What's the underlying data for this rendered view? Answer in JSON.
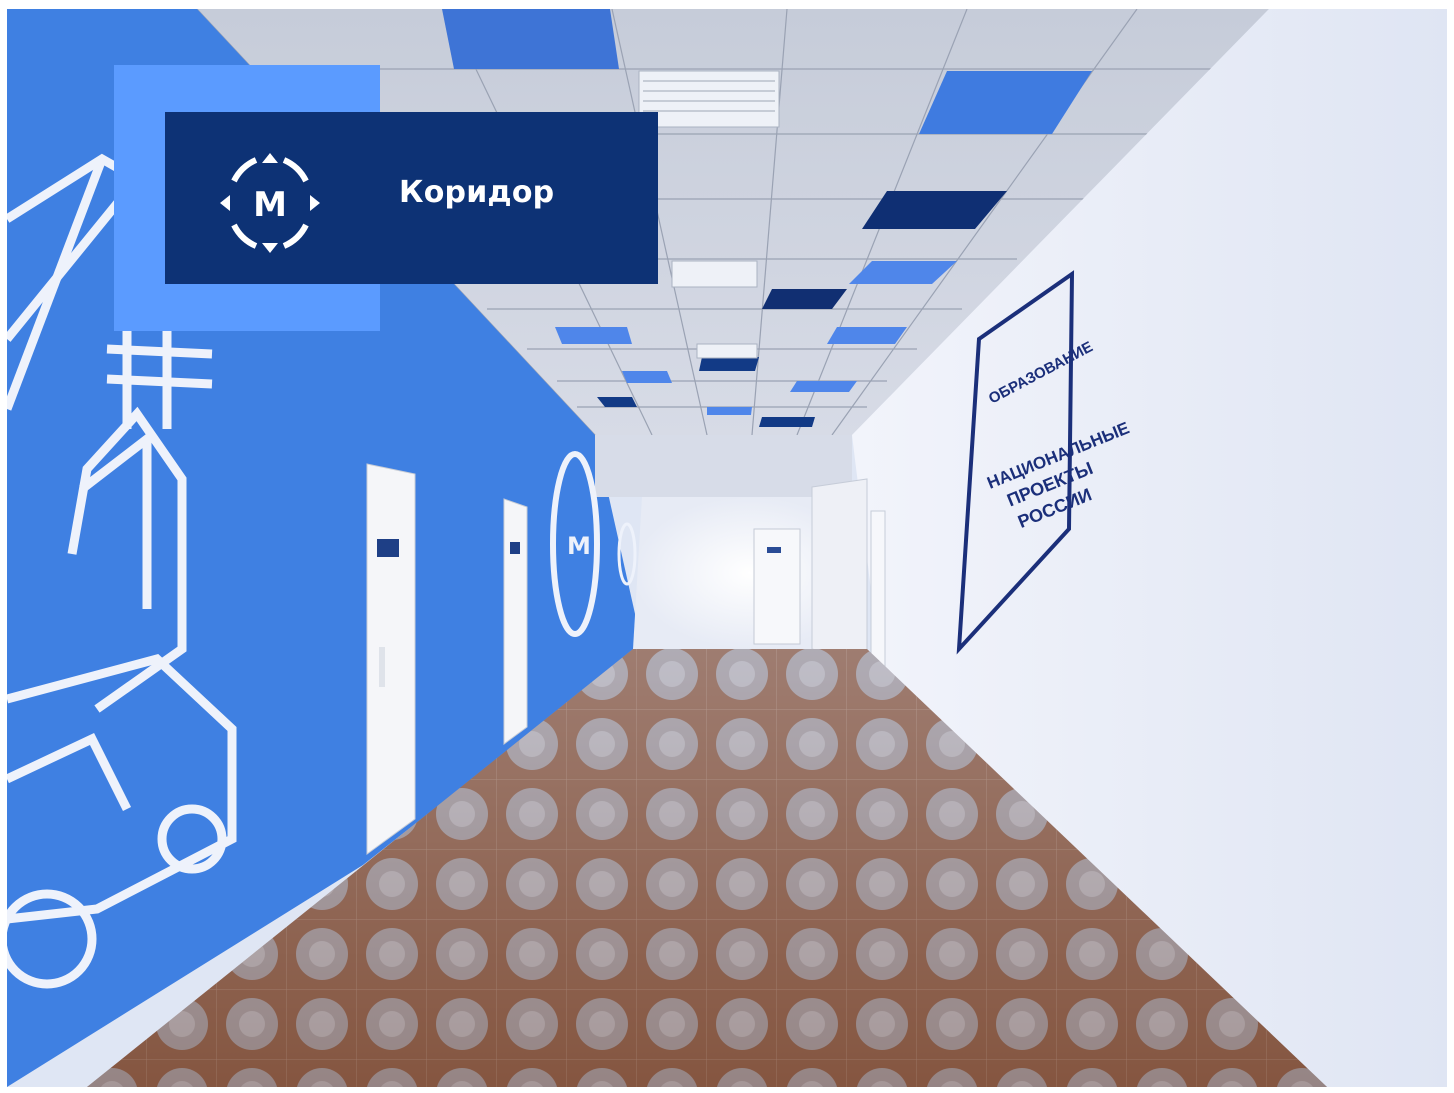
{
  "title": "Коридор",
  "logo_letter": "М",
  "poster": {
    "line1": "ОБРАЗОВАНИЕ",
    "line2": "НАЦИОНАЛЬНЫЕ",
    "line3": "ПРОЕКТЫ",
    "line4": "РОССИИ"
  },
  "colors": {
    "badge_dark": "#0d3275",
    "badge_light": "#5b9bff",
    "left_wall": "#3f7fe0",
    "right_wall": "#e6ecf8",
    "ceiling": "#c9d0dd",
    "floor": "#8a5a42"
  }
}
